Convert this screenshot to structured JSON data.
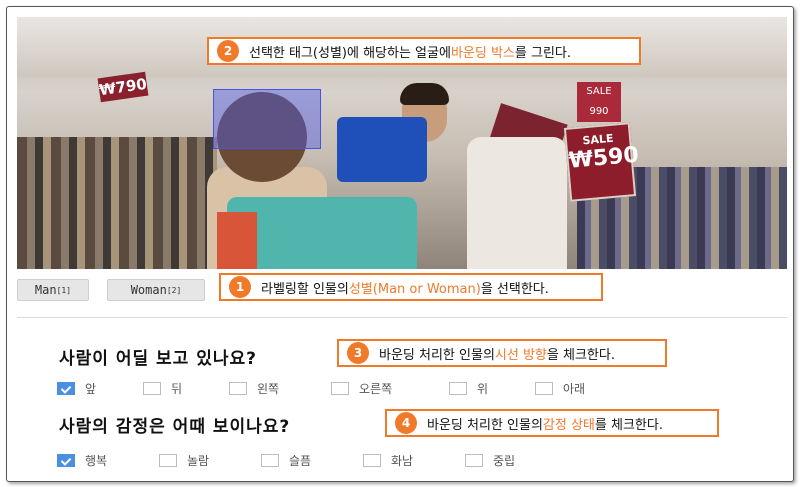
{
  "photo": {
    "price_tag_left": "₩790",
    "sale_tag_big_top": "SALE",
    "sale_tag_big_price": "₩590",
    "sale_tag_small": "SALE 990"
  },
  "callouts": [
    {
      "number": "1",
      "before": "라벨링할 인물의 ",
      "highlight": "성별(Man or Woman)",
      "after": "을 선택한다."
    },
    {
      "number": "2",
      "before": "선택한 태그(성별)에 해당하는 얼굴에 ",
      "highlight": "바운딩 박스",
      "after": "를 그린다."
    },
    {
      "number": "3",
      "before": "바운딩 처리한 인물의 ",
      "highlight": "시선 방향",
      "after": "을 체크한다."
    },
    {
      "number": "4",
      "before": "바운딩 처리한 인물의 ",
      "highlight": "감정 상태",
      "after": "를 체크한다."
    }
  ],
  "tags": [
    {
      "label": "Man",
      "key": "[1]"
    },
    {
      "label": "Woman",
      "key": "[2]"
    }
  ],
  "questions": {
    "gaze": {
      "text": "사람이 어딜 보고 있나요?",
      "options": [
        "앞",
        "뒤",
        "왼쪽",
        "오른쪽",
        "위",
        "아래"
      ],
      "checked": [
        true,
        false,
        false,
        false,
        false,
        false
      ]
    },
    "emotion": {
      "text": "사람의 감정은 어때 보이나요?",
      "options": [
        "행복",
        "놀람",
        "슬픔",
        "화남",
        "중립"
      ],
      "checked": [
        true,
        false,
        false,
        false,
        false
      ]
    }
  },
  "colors": {
    "accent": "#f07a2a",
    "check": "#4a90e2",
    "bbox": "#4b52e0"
  }
}
